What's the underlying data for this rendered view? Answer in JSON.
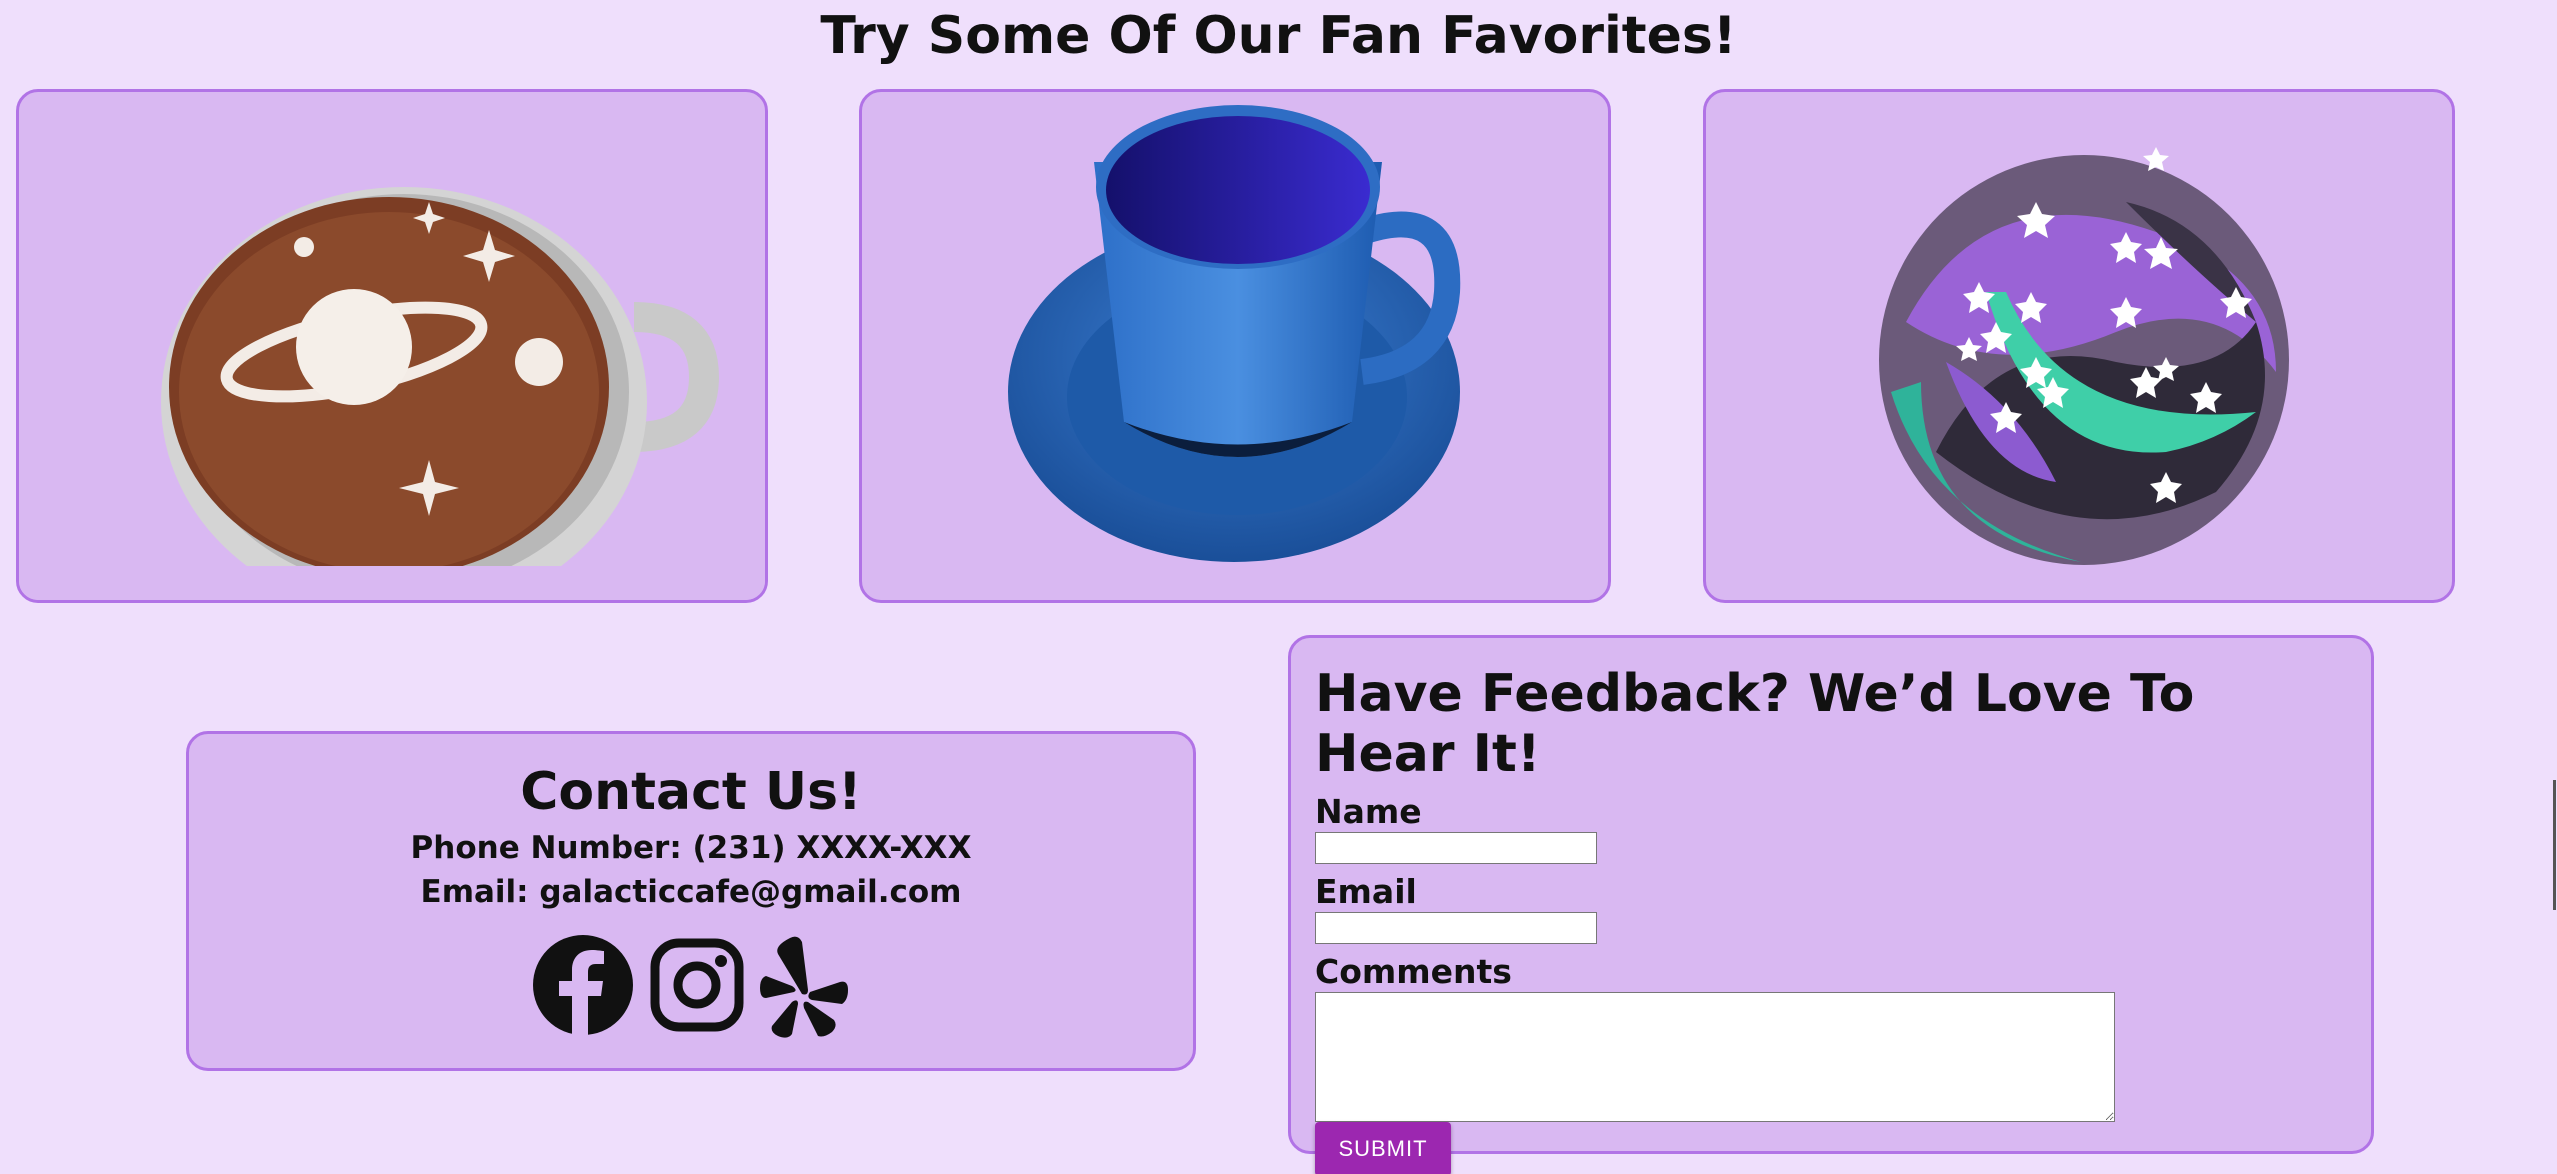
{
  "favorites": {
    "heading": "Try Some Of Our Fan Favorites!",
    "items": [
      {
        "icon": "space-latte-image"
      },
      {
        "icon": "blue-cup-saucer-image"
      },
      {
        "icon": "galaxy-cookie-image"
      }
    ]
  },
  "contact": {
    "title": "Contact Us!",
    "phone": "Phone Number: (231) XXXX-XXX",
    "email": "Email: galacticcafe@gmail.com",
    "socials": [
      "facebook-icon",
      "instagram-icon",
      "yelp-icon"
    ]
  },
  "feedback": {
    "title": "Have Feedback? We’d Love To Hear It!",
    "name_label": "Name",
    "name_value": "",
    "email_label": "Email",
    "email_value": "",
    "comments_label": "Comments",
    "comments_value": "",
    "submit_label": "SUBMIT"
  },
  "colors": {
    "page_bg": "#efdffc",
    "card_bg": "#d9b8f2",
    "card_border": "#b173e6",
    "submit_bg": "#9c27b0"
  }
}
